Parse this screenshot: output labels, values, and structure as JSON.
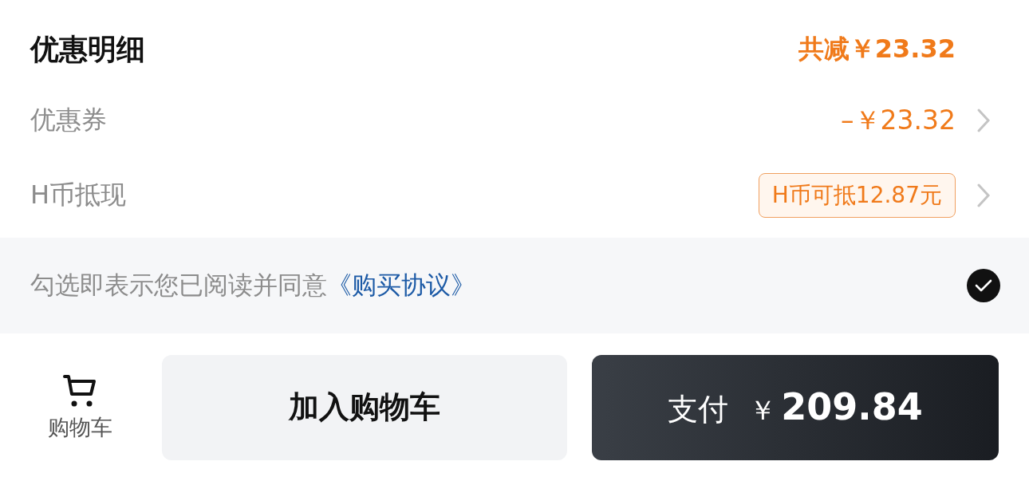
{
  "discount_detail": {
    "title": "优惠明细",
    "total": "共减￥23.32",
    "rows": [
      {
        "kind": "amount",
        "label": "优惠券",
        "value": "–￥23.32"
      },
      {
        "kind": "badge",
        "label": "H币抵现",
        "value": "H币可抵12.87元"
      }
    ]
  },
  "agreement": {
    "text": "勾选即表示您已阅读并同意",
    "link": "《购买协议》",
    "checked": true
  },
  "bottom_bar": {
    "cart": {
      "label": "购物车"
    },
    "add_to_cart": "加入购物车",
    "pay": {
      "label": "支付",
      "currency": "￥",
      "amount": "209.84"
    }
  }
}
